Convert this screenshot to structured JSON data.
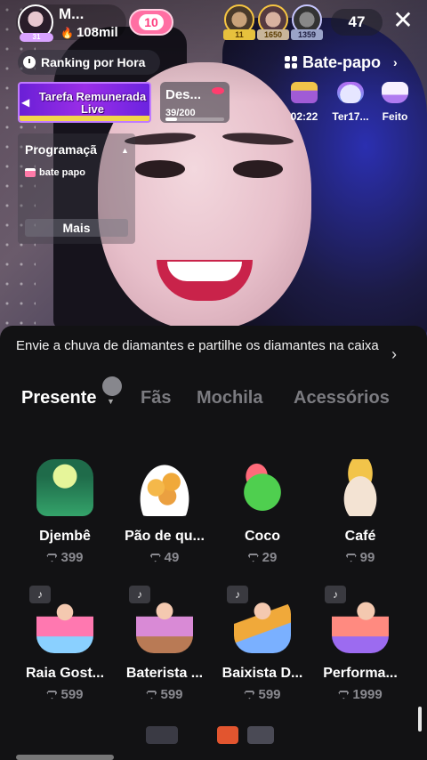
{
  "host": {
    "name": "M...",
    "level": "31",
    "likes": "108mil",
    "follow_count": "10"
  },
  "viewers": {
    "tags": [
      "11",
      "1650",
      "1359"
    ],
    "count": "47"
  },
  "ranking": {
    "label": "Ranking por Hora"
  },
  "chat": {
    "label": "Bate-papo"
  },
  "task_banner": {
    "text": "Tarefa Remunerada Live"
  },
  "des": {
    "title": "Des...",
    "progress_text": "39/200",
    "progress": 0.195
  },
  "side_icons": [
    {
      "label": "02:22",
      "icon": "treasure-chest-icon"
    },
    {
      "label": "Ter17...",
      "icon": "cloud-icon"
    },
    {
      "label": "Feito",
      "icon": "bunny-icon"
    }
  ],
  "program": {
    "title": "Programaçã",
    "item": "bate papo",
    "more": "Mais"
  },
  "sheet": {
    "promo": "Envie a chuva de diamantes e partilhe os diamantes na caixa",
    "tabs": [
      "Presente",
      "Fãs",
      "Mochila",
      "Acessórios"
    ],
    "active_tab": "Presente"
  },
  "gifts": [
    {
      "name": "Djembê",
      "price": "399"
    },
    {
      "name": "Pão de qu...",
      "price": "49"
    },
    {
      "name": "Coco",
      "price": "29"
    },
    {
      "name": "Café",
      "price": "99"
    },
    {
      "name": "Raia Gost...",
      "price": "599"
    },
    {
      "name": "Baterista ...",
      "price": "599"
    },
    {
      "name": "Baixista D...",
      "price": "599"
    },
    {
      "name": "Performa...",
      "price": "1999"
    }
  ],
  "colors": {
    "accent_pink": "#ff6fa3",
    "banner_purple": "#6a1fd6",
    "sheet_bg": "#121214",
    "muted_text": "#8a8a90"
  }
}
